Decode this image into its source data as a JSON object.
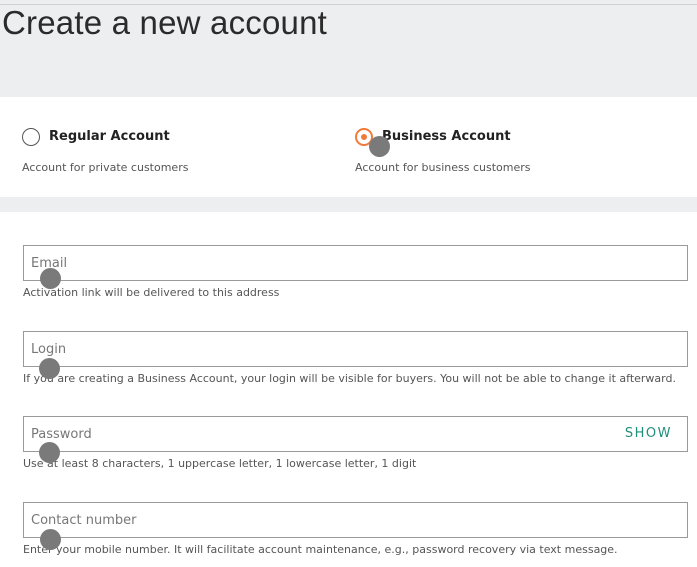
{
  "page": {
    "title": "Create a new account"
  },
  "account_types": {
    "regular": {
      "label": "Regular Account",
      "description": "Account for private customers",
      "selected": false
    },
    "business": {
      "label": "Business Account",
      "description": "Account for business customers",
      "selected": true
    }
  },
  "form": {
    "email": {
      "placeholder": "Email",
      "value": "",
      "hint": "Activation link will be delivered to this address"
    },
    "login": {
      "placeholder": "Login",
      "value": "",
      "hint": "If you are creating a Business Account, your login will be visible for buyers. You will not be able to change it afterward."
    },
    "password": {
      "placeholder": "Password",
      "value": "",
      "show_label": "SHOW",
      "hint": "Use at least 8 characters, 1 uppercase letter, 1 lowercase letter, 1 digit"
    },
    "contact": {
      "placeholder": "Contact number",
      "value": "",
      "hint": "Enter your mobile number. It will facilitate account maintenance, e.g., password recovery via text message."
    }
  },
  "colors": {
    "accent": "#f07a3a",
    "link": "#1f8f7a",
    "background": "#eceeef"
  }
}
